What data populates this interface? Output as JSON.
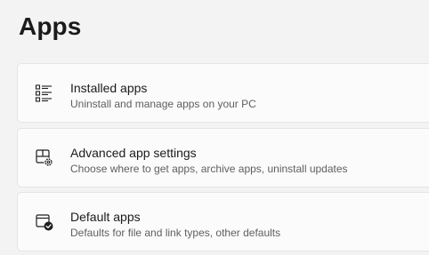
{
  "page": {
    "title": "Apps"
  },
  "items": [
    {
      "title": "Installed apps",
      "subtitle": "Uninstall and manage apps on your PC",
      "icon": "list-icon"
    },
    {
      "title": "Advanced app settings",
      "subtitle": "Choose where to get apps, archive apps, uninstall updates",
      "icon": "app-settings-icon"
    },
    {
      "title": "Default apps",
      "subtitle": "Defaults for file and link types, other defaults",
      "icon": "default-apps-icon"
    }
  ]
}
